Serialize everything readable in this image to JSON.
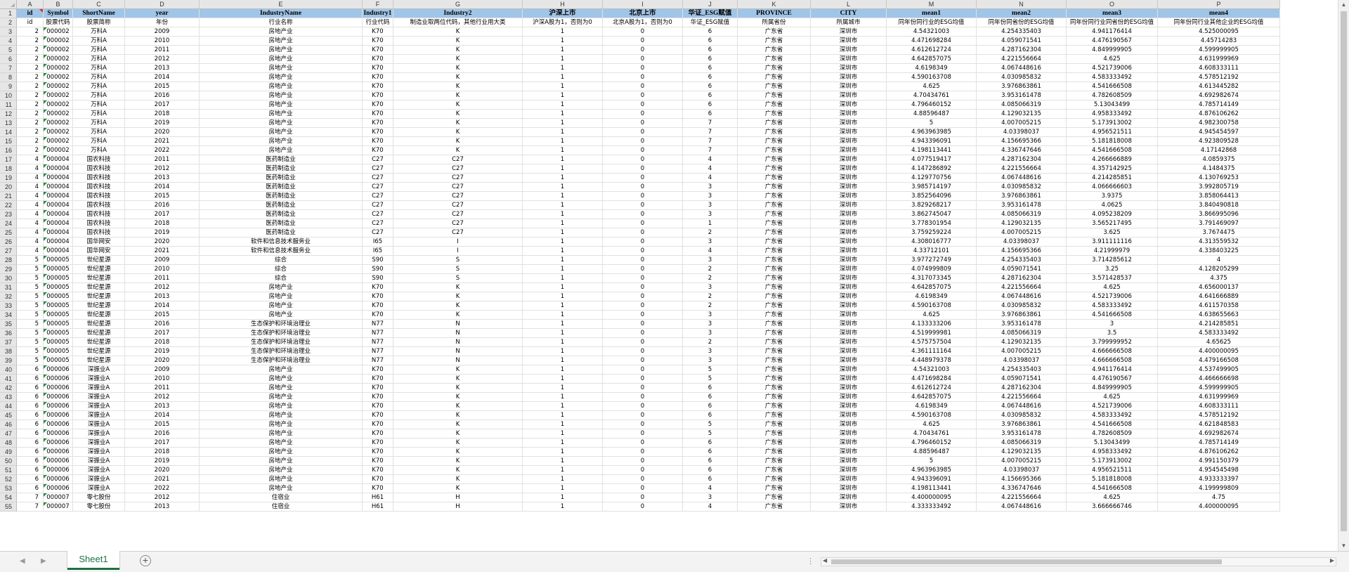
{
  "sheet": {
    "tab_name": "Sheet1",
    "add_sheet_icon": "plus-icon"
  },
  "columns": [
    "A",
    "B",
    "C",
    "D",
    "E",
    "F",
    "G",
    "H",
    "I",
    "J",
    "K",
    "L",
    "M",
    "N",
    "O",
    "P"
  ],
  "header_row": [
    "id",
    "Symbol",
    "ShortName",
    "year",
    "IndustryName",
    "Industry1",
    "Industry2",
    "沪深上市",
    "北京上市",
    "华证_ESG赋值",
    "PROVINCE",
    "CITY",
    "mean1",
    "mean2",
    "mean3",
    "mean4"
  ],
  "desc_row": [
    "id",
    "股票代码",
    "股票简称",
    "年份",
    "行业名称",
    "行业代码",
    "制造业取两位代码，其他行业用大类",
    "沪深A股为1，否则为0",
    "北京A股为1，否则为0",
    "华证_ESG赋值",
    "所属省份",
    "所属城市",
    "同年份同行业的ESG均值",
    "同年份同省份的ESG均值",
    "同年份同行业同省份的ESG均值",
    "同年份同行业其他企业的ESG均值"
  ],
  "rows": [
    [
      "2",
      "000002",
      "万科A",
      "2009",
      "房地产业",
      "K70",
      "K",
      "1",
      "0",
      "6",
      "广东省",
      "深圳市",
      "4.54321003",
      "4.254335403",
      "4.941176414",
      "4.525000095"
    ],
    [
      "2",
      "000002",
      "万科A",
      "2010",
      "房地产业",
      "K70",
      "K",
      "1",
      "0",
      "6",
      "广东省",
      "深圳市",
      "4.471698284",
      "4.059071541",
      "4.476190567",
      "4.45714283"
    ],
    [
      "2",
      "000002",
      "万科A",
      "2011",
      "房地产业",
      "K70",
      "K",
      "1",
      "0",
      "6",
      "广东省",
      "深圳市",
      "4.612612724",
      "4.287162304",
      "4.849999905",
      "4.599999905"
    ],
    [
      "2",
      "000002",
      "万科A",
      "2012",
      "房地产业",
      "K70",
      "K",
      "1",
      "0",
      "6",
      "广东省",
      "深圳市",
      "4.642857075",
      "4.221556664",
      "4.625",
      "4.631999969"
    ],
    [
      "2",
      "000002",
      "万科A",
      "2013",
      "房地产业",
      "K70",
      "K",
      "1",
      "0",
      "6",
      "广东省",
      "深圳市",
      "4.6198349",
      "4.067448616",
      "4.521739006",
      "4.608333111"
    ],
    [
      "2",
      "000002",
      "万科A",
      "2014",
      "房地产业",
      "K70",
      "K",
      "1",
      "0",
      "6",
      "广东省",
      "深圳市",
      "4.590163708",
      "4.030985832",
      "4.583333492",
      "4.578512192"
    ],
    [
      "2",
      "000002",
      "万科A",
      "2015",
      "房地产业",
      "K70",
      "K",
      "1",
      "0",
      "6",
      "广东省",
      "深圳市",
      "4.625",
      "3.976863861",
      "4.541666508",
      "4.613445282"
    ],
    [
      "2",
      "000002",
      "万科A",
      "2016",
      "房地产业",
      "K70",
      "K",
      "1",
      "0",
      "6",
      "广东省",
      "深圳市",
      "4.70434761",
      "3.953161478",
      "4.782608509",
      "4.692982674"
    ],
    [
      "2",
      "000002",
      "万科A",
      "2017",
      "房地产业",
      "K70",
      "K",
      "1",
      "0",
      "6",
      "广东省",
      "深圳市",
      "4.796460152",
      "4.085066319",
      "5.13043499",
      "4.785714149"
    ],
    [
      "2",
      "000002",
      "万科A",
      "2018",
      "房地产业",
      "K70",
      "K",
      "1",
      "0",
      "6",
      "广东省",
      "深圳市",
      "4.88596487",
      "4.129032135",
      "4.958333492",
      "4.876106262"
    ],
    [
      "2",
      "000002",
      "万科A",
      "2019",
      "房地产业",
      "K70",
      "K",
      "1",
      "0",
      "7",
      "广东省",
      "深圳市",
      "5",
      "4.007005215",
      "5.173913002",
      "4.982300758"
    ],
    [
      "2",
      "000002",
      "万科A",
      "2020",
      "房地产业",
      "K70",
      "K",
      "1",
      "0",
      "7",
      "广东省",
      "深圳市",
      "4.963963985",
      "4.03398037",
      "4.956521511",
      "4.945454597"
    ],
    [
      "2",
      "000002",
      "万科A",
      "2021",
      "房地产业",
      "K70",
      "K",
      "1",
      "0",
      "7",
      "广东省",
      "深圳市",
      "4.943396091",
      "4.156695366",
      "5.181818008",
      "4.923809528"
    ],
    [
      "2",
      "000002",
      "万科A",
      "2022",
      "房地产业",
      "K70",
      "K",
      "1",
      "0",
      "7",
      "广东省",
      "深圳市",
      "4.198113441",
      "4.336747646",
      "4.541666508",
      "4.17142868"
    ],
    [
      "4",
      "000004",
      "国农科技",
      "2011",
      "医药制造业",
      "C27",
      "C27",
      "1",
      "0",
      "4",
      "广东省",
      "深圳市",
      "4.077519417",
      "4.287162304",
      "4.266666889",
      "4.0859375"
    ],
    [
      "4",
      "000004",
      "国农科技",
      "2012",
      "医药制造业",
      "C27",
      "C27",
      "1",
      "0",
      "4",
      "广东省",
      "深圳市",
      "4.147286892",
      "4.221556664",
      "4.357142925",
      "4.1484375"
    ],
    [
      "4",
      "000004",
      "国农科技",
      "2013",
      "医药制造业",
      "C27",
      "C27",
      "1",
      "0",
      "4",
      "广东省",
      "深圳市",
      "4.129770756",
      "4.067448616",
      "4.214285851",
      "4.130769253"
    ],
    [
      "4",
      "000004",
      "国农科技",
      "2014",
      "医药制造业",
      "C27",
      "C27",
      "1",
      "0",
      "3",
      "广东省",
      "深圳市",
      "3.985714197",
      "4.030985832",
      "4.066666603",
      "3.992805719"
    ],
    [
      "4",
      "000004",
      "国农科技",
      "2015",
      "医药制造业",
      "C27",
      "C27",
      "1",
      "0",
      "3",
      "广东省",
      "深圳市",
      "3.852564096",
      "3.976863861",
      "3.9375",
      "3.858064413"
    ],
    [
      "4",
      "000004",
      "国农科技",
      "2016",
      "医药制造业",
      "C27",
      "C27",
      "1",
      "0",
      "3",
      "广东省",
      "深圳市",
      "3.829268217",
      "3.953161478",
      "4.0625",
      "3.840490818"
    ],
    [
      "4",
      "000004",
      "国农科技",
      "2017",
      "医药制造业",
      "C27",
      "C27",
      "1",
      "0",
      "3",
      "广东省",
      "深圳市",
      "3.862745047",
      "4.085066319",
      "4.095238209",
      "3.866995096"
    ],
    [
      "4",
      "000004",
      "国农科技",
      "2018",
      "医药制造业",
      "C27",
      "C27",
      "1",
      "0",
      "1",
      "广东省",
      "深圳市",
      "3.778301954",
      "4.129032135",
      "3.565217495",
      "3.791469097"
    ],
    [
      "4",
      "000004",
      "国农科技",
      "2019",
      "医药制造业",
      "C27",
      "C27",
      "1",
      "0",
      "2",
      "广东省",
      "深圳市",
      "3.759259224",
      "4.007005215",
      "3.625",
      "3.7674475"
    ],
    [
      "4",
      "000004",
      "国华网安",
      "2020",
      "软件和信息技术服务业",
      "I65",
      "I",
      "1",
      "0",
      "3",
      "广东省",
      "深圳市",
      "4.308016777",
      "4.03398037",
      "3.911111116",
      "4.313559532"
    ],
    [
      "4",
      "000004",
      "国华网安",
      "2021",
      "软件和信息技术服务业",
      "I65",
      "I",
      "1",
      "0",
      "4",
      "广东省",
      "深圳市",
      "4.33712101",
      "4.156695366",
      "4.21999979",
      "4.338403225"
    ],
    [
      "5",
      "000005",
      "世纪星源",
      "2009",
      "综合",
      "S90",
      "S",
      "1",
      "0",
      "3",
      "广东省",
      "深圳市",
      "3.977272749",
      "4.254335403",
      "3.714285612",
      "4"
    ],
    [
      "5",
      "000005",
      "世纪星源",
      "2010",
      "综合",
      "S90",
      "S",
      "1",
      "0",
      "2",
      "广东省",
      "深圳市",
      "4.074999809",
      "4.059071541",
      "3.25",
      "4.128205299"
    ],
    [
      "5",
      "000005",
      "世纪星源",
      "2011",
      "综合",
      "S90",
      "S",
      "1",
      "0",
      "2",
      "广东省",
      "深圳市",
      "4.317073345",
      "4.287162304",
      "3.571428537",
      "4.375"
    ],
    [
      "5",
      "000005",
      "世纪星源",
      "2012",
      "房地产业",
      "K70",
      "K",
      "1",
      "0",
      "3",
      "广东省",
      "深圳市",
      "4.642857075",
      "4.221556664",
      "4.625",
      "4.656000137"
    ],
    [
      "5",
      "000005",
      "世纪星源",
      "2013",
      "房地产业",
      "K70",
      "K",
      "1",
      "0",
      "2",
      "广东省",
      "深圳市",
      "4.6198349",
      "4.067448616",
      "4.521739006",
      "4.641666889"
    ],
    [
      "5",
      "000005",
      "世纪星源",
      "2014",
      "房地产业",
      "K70",
      "K",
      "1",
      "0",
      "2",
      "广东省",
      "深圳市",
      "4.590163708",
      "4.030985832",
      "4.583333492",
      "4.611570358"
    ],
    [
      "5",
      "000005",
      "世纪星源",
      "2015",
      "房地产业",
      "K70",
      "K",
      "1",
      "0",
      "3",
      "广东省",
      "深圳市",
      "4.625",
      "3.976863861",
      "4.541666508",
      "4.638655663"
    ],
    [
      "5",
      "000005",
      "世纪星源",
      "2016",
      "生态保护和环境治理业",
      "N77",
      "N",
      "1",
      "0",
      "3",
      "广东省",
      "深圳市",
      "4.133333206",
      "3.953161478",
      "3",
      "4.214285851"
    ],
    [
      "5",
      "000005",
      "世纪星源",
      "2017",
      "生态保护和环境治理业",
      "N77",
      "N",
      "1",
      "0",
      "3",
      "广东省",
      "深圳市",
      "4.519999981",
      "4.085066319",
      "3.5",
      "4.583333492"
    ],
    [
      "5",
      "000005",
      "世纪星源",
      "2018",
      "生态保护和环境治理业",
      "N77",
      "N",
      "1",
      "0",
      "2",
      "广东省",
      "深圳市",
      "4.575757504",
      "4.129032135",
      "3.799999952",
      "4.65625"
    ],
    [
      "5",
      "000005",
      "世纪星源",
      "2019",
      "生态保护和环境治理业",
      "N77",
      "N",
      "1",
      "0",
      "3",
      "广东省",
      "深圳市",
      "4.361111164",
      "4.007005215",
      "4.666666508",
      "4.400000095"
    ],
    [
      "5",
      "000005",
      "世纪星源",
      "2020",
      "生态保护和环境治理业",
      "N77",
      "N",
      "1",
      "0",
      "3",
      "广东省",
      "深圳市",
      "4.448979378",
      "4.03398037",
      "4.666666508",
      "4.479166508"
    ],
    [
      "6",
      "000006",
      "深振业A",
      "2009",
      "房地产业",
      "K70",
      "K",
      "1",
      "0",
      "5",
      "广东省",
      "深圳市",
      "4.54321003",
      "4.254335403",
      "4.941176414",
      "4.537499905"
    ],
    [
      "6",
      "000006",
      "深振业A",
      "2010",
      "房地产业",
      "K70",
      "K",
      "1",
      "0",
      "5",
      "广东省",
      "深圳市",
      "4.471698284",
      "4.059071541",
      "4.476190567",
      "4.466666698"
    ],
    [
      "6",
      "000006",
      "深振业A",
      "2011",
      "房地产业",
      "K70",
      "K",
      "1",
      "0",
      "6",
      "广东省",
      "深圳市",
      "4.612612724",
      "4.287162304",
      "4.849999905",
      "4.599999905"
    ],
    [
      "6",
      "000006",
      "深振业A",
      "2012",
      "房地产业",
      "K70",
      "K",
      "1",
      "0",
      "6",
      "广东省",
      "深圳市",
      "4.642857075",
      "4.221556664",
      "4.625",
      "4.631999969"
    ],
    [
      "6",
      "000006",
      "深振业A",
      "2013",
      "房地产业",
      "K70",
      "K",
      "1",
      "0",
      "6",
      "广东省",
      "深圳市",
      "4.6198349",
      "4.067448616",
      "4.521739006",
      "4.608333111"
    ],
    [
      "6",
      "000006",
      "深振业A",
      "2014",
      "房地产业",
      "K70",
      "K",
      "1",
      "0",
      "6",
      "广东省",
      "深圳市",
      "4.590163708",
      "4.030985832",
      "4.583333492",
      "4.578512192"
    ],
    [
      "6",
      "000006",
      "深振业A",
      "2015",
      "房地产业",
      "K70",
      "K",
      "1",
      "0",
      "5",
      "广东省",
      "深圳市",
      "4.625",
      "3.976863861",
      "4.541666508",
      "4.621848583"
    ],
    [
      "6",
      "000006",
      "深振业A",
      "2016",
      "房地产业",
      "K70",
      "K",
      "1",
      "0",
      "5",
      "广东省",
      "深圳市",
      "4.70434761",
      "3.953161478",
      "4.782608509",
      "4.692982674"
    ],
    [
      "6",
      "000006",
      "深振业A",
      "2017",
      "房地产业",
      "K70",
      "K",
      "1",
      "0",
      "6",
      "广东省",
      "深圳市",
      "4.796460152",
      "4.085066319",
      "5.13043499",
      "4.785714149"
    ],
    [
      "6",
      "000006",
      "深振业A",
      "2018",
      "房地产业",
      "K70",
      "K",
      "1",
      "0",
      "6",
      "广东省",
      "深圳市",
      "4.88596487",
      "4.129032135",
      "4.958333492",
      "4.876106262"
    ],
    [
      "6",
      "000006",
      "深振业A",
      "2019",
      "房地产业",
      "K70",
      "K",
      "1",
      "0",
      "6",
      "广东省",
      "深圳市",
      "5",
      "4.007005215",
      "5.173913002",
      "4.991150379"
    ],
    [
      "6",
      "000006",
      "深振业A",
      "2020",
      "房地产业",
      "K70",
      "K",
      "1",
      "0",
      "6",
      "广东省",
      "深圳市",
      "4.963963985",
      "4.03398037",
      "4.956521511",
      "4.954545498"
    ],
    [
      "6",
      "000006",
      "深振业A",
      "2021",
      "房地产业",
      "K70",
      "K",
      "1",
      "0",
      "6",
      "广东省",
      "深圳市",
      "4.943396091",
      "4.156695366",
      "5.181818008",
      "4.933333397"
    ],
    [
      "6",
      "000006",
      "深振业A",
      "2022",
      "房地产业",
      "K70",
      "K",
      "1",
      "0",
      "4",
      "广东省",
      "深圳市",
      "4.198113441",
      "4.336747646",
      "4.541666508",
      "4.199999809"
    ],
    [
      "7",
      "000007",
      "零七股份",
      "2012",
      "住宿业",
      "H61",
      "H",
      "1",
      "0",
      "3",
      "广东省",
      "深圳市",
      "4.400000095",
      "4.221556664",
      "4.625",
      "4.75"
    ],
    [
      "7",
      "000007",
      "零七股份",
      "2013",
      "住宿业",
      "H61",
      "H",
      "1",
      "0",
      "4",
      "广东省",
      "深圳市",
      "4.333333492",
      "4.067448616",
      "3.666666746",
      "4.400000095"
    ]
  ]
}
